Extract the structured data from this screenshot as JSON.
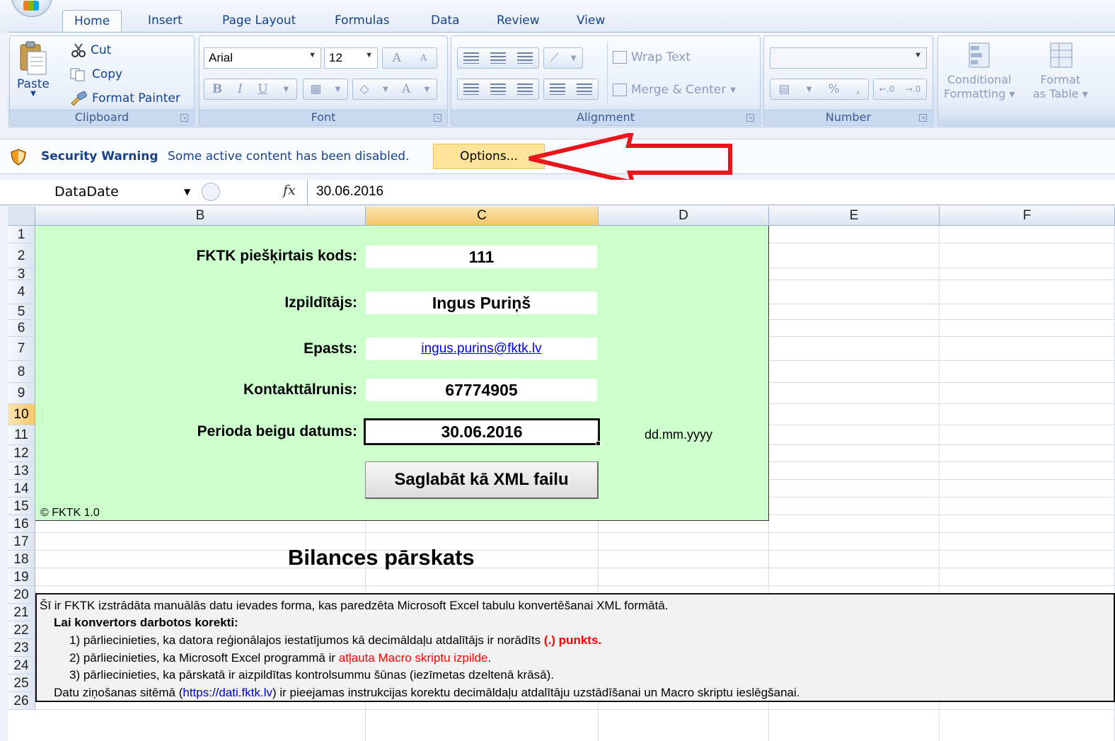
{
  "tabs": [
    "Home",
    "Insert",
    "Page Layout",
    "Formulas",
    "Data",
    "Review",
    "View"
  ],
  "clipboard": {
    "paste": "Paste",
    "cut": "Cut",
    "copy": "Copy",
    "format_painter": "Format Painter",
    "label": "Clipboard"
  },
  "font": {
    "name": "Arial",
    "size": "12",
    "bold": "B",
    "italic": "I",
    "underline": "U",
    "grow": "A",
    "shrink": "A",
    "color": "A",
    "label": "Font"
  },
  "alignment": {
    "wrap_text": "Wrap Text",
    "merge_center": "Merge & Center",
    "label": "Alignment"
  },
  "number": {
    "percent": "%",
    "comma": ",",
    "label": "Number"
  },
  "styles": {
    "conditional": "Conditional",
    "formatting": "Formatting",
    "format": "Format",
    "as_table": "as Table"
  },
  "security": {
    "title": "Security Warning",
    "message": "Some active content has been disabled.",
    "options": "Options..."
  },
  "formula_bar": {
    "name_box": "DataDate",
    "fx": "fx",
    "value": "30.06.2016"
  },
  "columns": [
    "B",
    "C",
    "D",
    "E",
    "F"
  ],
  "rows": [
    "1",
    "2",
    "3",
    "4",
    "5",
    "6",
    "7",
    "8",
    "9",
    "10",
    "11",
    "12",
    "13",
    "14",
    "15",
    "16",
    "17",
    "18",
    "19",
    "20",
    "21",
    "22",
    "23",
    "24",
    "25",
    "26"
  ],
  "form": {
    "code_label": "FKTK piešķirtais kods:",
    "code_value": "111",
    "executor_label": "Izpildītājs:",
    "executor_value": "Ingus Puriņš",
    "email_label": "Epasts:",
    "email_value": "ingus.purins@fktk.lv",
    "phone_label": "Kontakttālrunis:",
    "phone_value": "67774905",
    "date_label": "Perioda beigu datums:",
    "date_value": "30.06.2016",
    "date_hint": "dd.mm.yyyy",
    "save_button": "Saglabāt kā XML failu",
    "copyright": "© FKTK 1.0"
  },
  "report_title": "Bilances pārskats",
  "info": {
    "line1": "Šī ir FKTK izstrādāta manuālās datu ievades forma, kas paredzēta Microsoft Excel tabulu konvertēšanai XML formātā.",
    "line2": "Lai konvertors darbotos korekti:",
    "line3a": "1) pārliecinieties, ka datora reģionālajos iestatījumos kā decimāldaļu atdalītājs ir norādīts ",
    "line3b": "(.) punkts.",
    "line4a": "2) pārliecinieties, ka Microsoft Excel programmā ir ",
    "line4b": "atļauta Macro skriptu izpilde",
    "line4c": ".",
    "line5": "3) pārliecinieties, ka pārskatā ir aizpildītas kontrolsummu šūnas (iezīmetas dzeltenā krāsā).",
    "line6a": "Datu ziņošanas sitēmā (",
    "line6b": "https://dati.fktk.lv",
    "line6c": ") ir pieejamas instrukcijas korektu decimāldaļu atdalītāju uzstādīšanai un Macro skriptu ieslēgšanai."
  },
  "colors": {
    "green_fill": "#ccffcc",
    "options_bg": "#fde49a",
    "arrow": "#e8151b",
    "selected_header": "#f6c866"
  }
}
